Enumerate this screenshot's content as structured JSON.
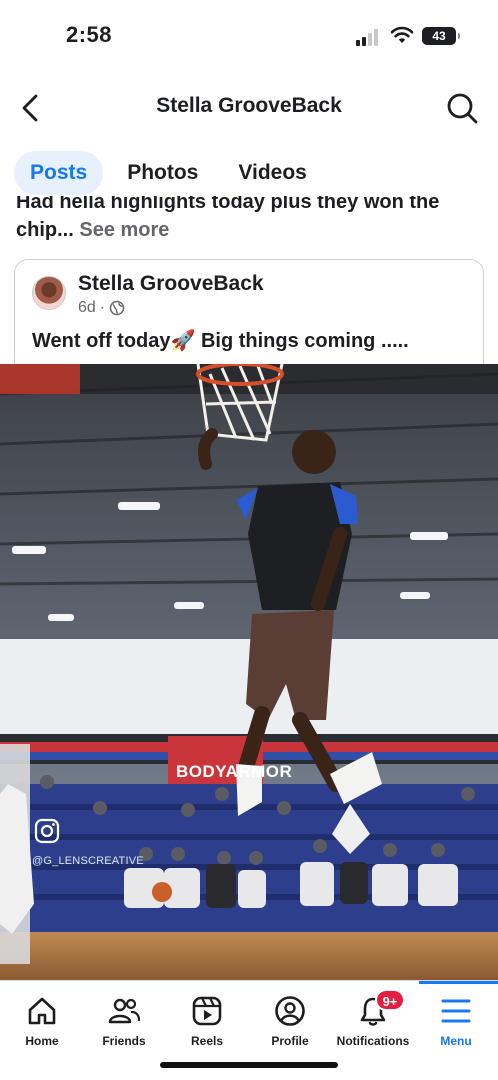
{
  "status_bar": {
    "time": "2:58",
    "battery": "43",
    "icons": [
      "signal-icon",
      "wifi-icon",
      "battery-icon"
    ]
  },
  "header": {
    "title": "Stella GrooveBack",
    "back_icon": "chevron-left-icon",
    "search_icon": "search-icon"
  },
  "tabs": [
    {
      "label": "Posts",
      "active": true
    },
    {
      "label": "Photos",
      "active": false
    },
    {
      "label": "Videos",
      "active": false
    }
  ],
  "post": {
    "caption_line1": "Had hella highlights today plus they won the",
    "caption_line2": "chip...",
    "see_more": "See more",
    "shared": {
      "author": "Stella GrooveBack",
      "time": "6d",
      "privacy_icon": "globe-icon",
      "text": "Went off today🚀 Big things coming ....."
    },
    "video": {
      "watermark_handle": "@G_LENSCREATIVE",
      "banner_text": "BODYARMOR"
    }
  },
  "bottom_nav": {
    "items": [
      {
        "label": "Home",
        "icon": "home-icon"
      },
      {
        "label": "Friends",
        "icon": "friends-icon"
      },
      {
        "label": "Reels",
        "icon": "reels-icon"
      },
      {
        "label": "Profile",
        "icon": "profile-icon"
      },
      {
        "label": "Notifications",
        "icon": "bell-icon",
        "badge": "9+"
      },
      {
        "label": "Menu",
        "icon": "menu-icon",
        "active": true
      }
    ]
  },
  "colors": {
    "accent": "#1877f2",
    "badge": "#e41e3f",
    "tab_active_bg": "#e7f0fd",
    "secondary_text": "#65676b"
  }
}
